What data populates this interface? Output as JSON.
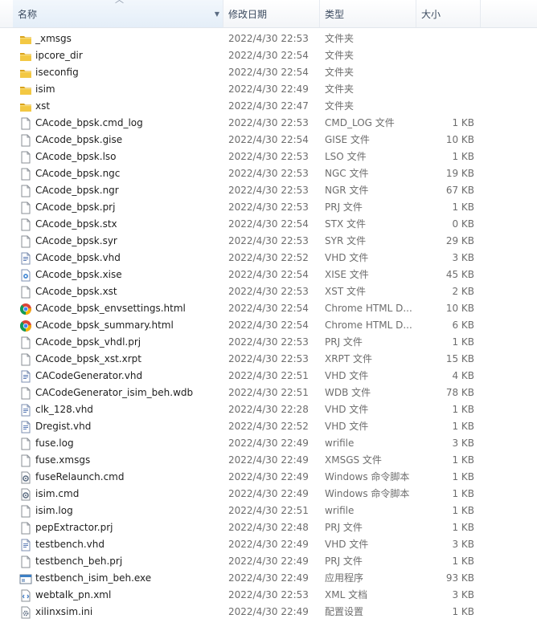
{
  "columns": {
    "name": "名称",
    "date": "修改日期",
    "type": "类型",
    "size": "大小"
  },
  "colors": {
    "folder": "#f3c843",
    "folder_dark": "#d9a21b",
    "chrome_red": "#db4437",
    "chrome_yellow": "#f4b400",
    "chrome_green": "#0f9d58",
    "chrome_blue": "#4285f4"
  },
  "files": [
    {
      "name": "_xmsgs",
      "date": "2022/4/30 22:53",
      "type": "文件夹",
      "size": "",
      "icon": "folder-icon"
    },
    {
      "name": "ipcore_dir",
      "date": "2022/4/30 22:54",
      "type": "文件夹",
      "size": "",
      "icon": "folder-icon"
    },
    {
      "name": "iseconfig",
      "date": "2022/4/30 22:54",
      "type": "文件夹",
      "size": "",
      "icon": "folder-icon"
    },
    {
      "name": "isim",
      "date": "2022/4/30 22:49",
      "type": "文件夹",
      "size": "",
      "icon": "folder-icon"
    },
    {
      "name": "xst",
      "date": "2022/4/30 22:47",
      "type": "文件夹",
      "size": "",
      "icon": "folder-icon"
    },
    {
      "name": "CAcode_bpsk.cmd_log",
      "date": "2022/4/30 22:53",
      "type": "CMD_LOG 文件",
      "size": "1 KB",
      "icon": "file-icon"
    },
    {
      "name": "CAcode_bpsk.gise",
      "date": "2022/4/30 22:54",
      "type": "GISE 文件",
      "size": "10 KB",
      "icon": "file-icon"
    },
    {
      "name": "CAcode_bpsk.lso",
      "date": "2022/4/30 22:53",
      "type": "LSO 文件",
      "size": "1 KB",
      "icon": "file-icon"
    },
    {
      "name": "CAcode_bpsk.ngc",
      "date": "2022/4/30 22:53",
      "type": "NGC 文件",
      "size": "19 KB",
      "icon": "file-icon"
    },
    {
      "name": "CAcode_bpsk.ngr",
      "date": "2022/4/30 22:53",
      "type": "NGR 文件",
      "size": "67 KB",
      "icon": "file-icon"
    },
    {
      "name": "CAcode_bpsk.prj",
      "date": "2022/4/30 22:53",
      "type": "PRJ 文件",
      "size": "1 KB",
      "icon": "file-icon"
    },
    {
      "name": "CAcode_bpsk.stx",
      "date": "2022/4/30 22:54",
      "type": "STX 文件",
      "size": "0 KB",
      "icon": "file-icon"
    },
    {
      "name": "CAcode_bpsk.syr",
      "date": "2022/4/30 22:53",
      "type": "SYR 文件",
      "size": "29 KB",
      "icon": "file-icon"
    },
    {
      "name": "CAcode_bpsk.vhd",
      "date": "2022/4/30 22:52",
      "type": "VHD 文件",
      "size": "3 KB",
      "icon": "vhd-file-icon"
    },
    {
      "name": "CAcode_bpsk.xise",
      "date": "2022/4/30 22:54",
      "type": "XISE 文件",
      "size": "45 KB",
      "icon": "xise-file-icon"
    },
    {
      "name": "CAcode_bpsk.xst",
      "date": "2022/4/30 22:53",
      "type": "XST 文件",
      "size": "2 KB",
      "icon": "file-icon"
    },
    {
      "name": "CAcode_bpsk_envsettings.html",
      "date": "2022/4/30 22:54",
      "type": "Chrome HTML D...",
      "size": "10 KB",
      "icon": "chrome-icon"
    },
    {
      "name": "CAcode_bpsk_summary.html",
      "date": "2022/4/30 22:54",
      "type": "Chrome HTML D...",
      "size": "6 KB",
      "icon": "chrome-icon"
    },
    {
      "name": "CAcode_bpsk_vhdl.prj",
      "date": "2022/4/30 22:53",
      "type": "PRJ 文件",
      "size": "1 KB",
      "icon": "file-icon"
    },
    {
      "name": "CAcode_bpsk_xst.xrpt",
      "date": "2022/4/30 22:53",
      "type": "XRPT 文件",
      "size": "15 KB",
      "icon": "file-icon"
    },
    {
      "name": "CACodeGenerator.vhd",
      "date": "2022/4/30 22:51",
      "type": "VHD 文件",
      "size": "4 KB",
      "icon": "vhd-file-icon"
    },
    {
      "name": "CACodeGenerator_isim_beh.wdb",
      "date": "2022/4/30 22:51",
      "type": "WDB 文件",
      "size": "78 KB",
      "icon": "file-icon"
    },
    {
      "name": "clk_128.vhd",
      "date": "2022/4/30 22:28",
      "type": "VHD 文件",
      "size": "1 KB",
      "icon": "vhd-file-icon"
    },
    {
      "name": "Dregist.vhd",
      "date": "2022/4/30 22:52",
      "type": "VHD 文件",
      "size": "1 KB",
      "icon": "vhd-file-icon"
    },
    {
      "name": "fuse.log",
      "date": "2022/4/30 22:49",
      "type": "wrifile",
      "size": "3 KB",
      "icon": "file-icon"
    },
    {
      "name": "fuse.xmsgs",
      "date": "2022/4/30 22:49",
      "type": "XMSGS 文件",
      "size": "1 KB",
      "icon": "file-icon"
    },
    {
      "name": "fuseRelaunch.cmd",
      "date": "2022/4/30 22:49",
      "type": "Windows 命令脚本",
      "size": "1 KB",
      "icon": "cmd-script-icon"
    },
    {
      "name": "isim.cmd",
      "date": "2022/4/30 22:49",
      "type": "Windows 命令脚本",
      "size": "1 KB",
      "icon": "cmd-script-icon"
    },
    {
      "name": "isim.log",
      "date": "2022/4/30 22:51",
      "type": "wrifile",
      "size": "1 KB",
      "icon": "file-icon"
    },
    {
      "name": "pepExtractor.prj",
      "date": "2022/4/30 22:48",
      "type": "PRJ 文件",
      "size": "1 KB",
      "icon": "file-icon"
    },
    {
      "name": "testbench.vhd",
      "date": "2022/4/30 22:49",
      "type": "VHD 文件",
      "size": "3 KB",
      "icon": "vhd-file-icon"
    },
    {
      "name": "testbench_beh.prj",
      "date": "2022/4/30 22:49",
      "type": "PRJ 文件",
      "size": "1 KB",
      "icon": "file-icon"
    },
    {
      "name": "testbench_isim_beh.exe",
      "date": "2022/4/30 22:49",
      "type": "应用程序",
      "size": "93 KB",
      "icon": "exe-icon"
    },
    {
      "name": "webtalk_pn.xml",
      "date": "2022/4/30 22:53",
      "type": "XML 文档",
      "size": "3 KB",
      "icon": "xml-file-icon"
    },
    {
      "name": "xilinxsim.ini",
      "date": "2022/4/30 22:49",
      "type": "配置设置",
      "size": "1 KB",
      "icon": "ini-settings-icon"
    }
  ]
}
